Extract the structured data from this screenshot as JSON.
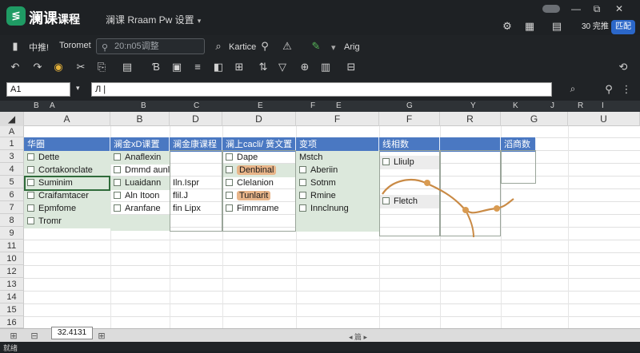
{
  "app": {
    "logo_glyph": "≶",
    "name": "澜课",
    "name_sub": "课程",
    "doc_title": "澜课 Rraam Pw 设置"
  },
  "window_controls": [
    "—",
    "⧉",
    "✕"
  ],
  "top_right": {
    "login": "30 完推",
    "share": "匹配"
  },
  "menu": {
    "items": [
      "中推!",
      "Toromet"
    ],
    "search_placeholder": "20:n05调整",
    "review": "Kartice",
    "arg": "Arig"
  },
  "namebox": "A1",
  "formula": "Л |",
  "top_letters": [
    "B",
    "A",
    "B",
    "C",
    "E",
    "F",
    "E",
    "G",
    "Y",
    "K",
    "J",
    "R",
    "I"
  ],
  "columns": [
    "A",
    "B",
    "D",
    "D",
    "F",
    "F",
    "R",
    "G",
    "U"
  ],
  "rows": [
    "A",
    "1",
    "3",
    "4",
    "5",
    "6",
    "7",
    "8",
    "9",
    "11",
    "10",
    "12",
    "13",
    "14",
    "15",
    "16"
  ],
  "headers": [
    "华圈",
    "澜金xD课置",
    "澜金康课程",
    "澜上cacli/ 簧文置",
    "变项",
    "线相数",
    "",
    "滔商数"
  ],
  "colA": [
    "Dette",
    "Cortakonclate",
    "Suminim",
    "Craifamtacer",
    "Epmfome",
    "Tromr"
  ],
  "colB": [
    "Anaflexin",
    "Dmmd aunl",
    "Luaidann",
    "Aln Itoon",
    "Aranfane"
  ],
  "colD": [
    "",
    "",
    "Iln.Ispr",
    "flil.J",
    "fin  Lipx"
  ],
  "colE": [
    "Dape",
    "Denbinal",
    "Clelanion",
    "Tunlarit",
    "Fimmrame"
  ],
  "colF": [
    "Mstch",
    "Aberiin",
    "Sotnm",
    "Rmine",
    "Innclnung"
  ],
  "colG": [
    "Lliulp",
    "",
    "",
    "Fletch"
  ],
  "sheet_tab": "32.4131",
  "status_left": "就绪",
  "status_mid": "◂ 篇 ▸",
  "colors": {
    "header_blue": "#4a78c2",
    "cell_green": "#dce8dc",
    "accent_orange": "#c98a45",
    "share_blue": "#2b67c9"
  }
}
